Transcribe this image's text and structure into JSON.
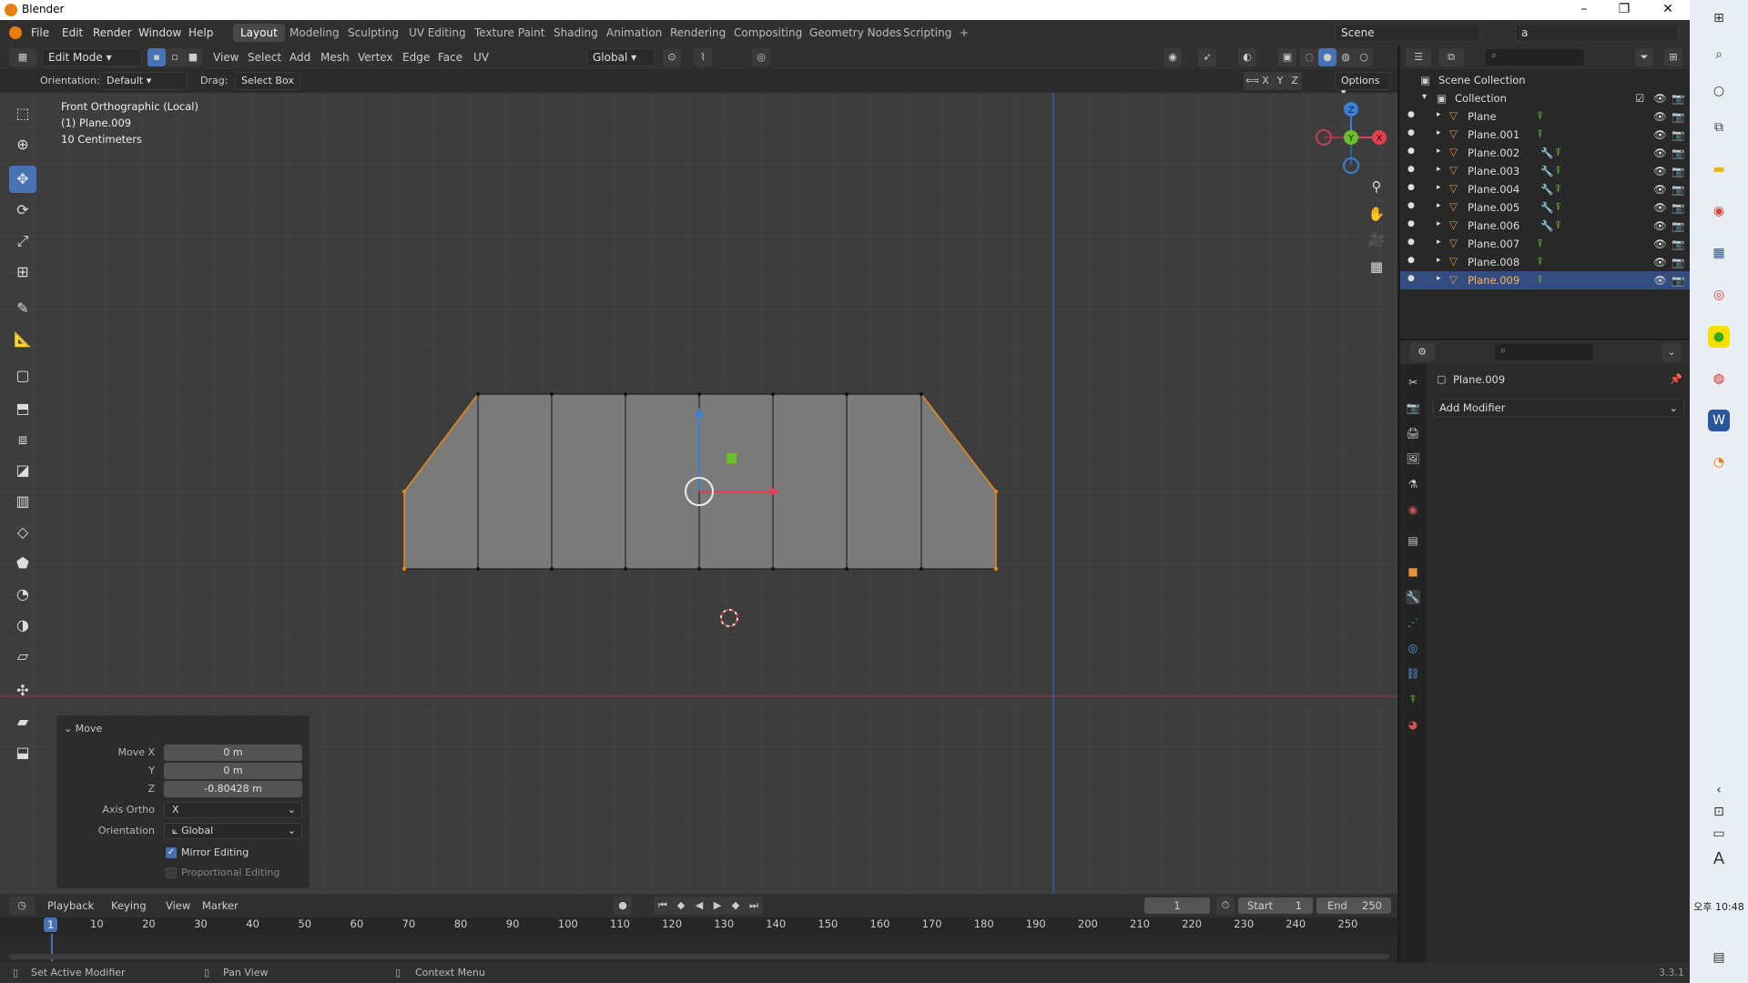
{
  "window": {
    "title": "Blender",
    "minimize": "–",
    "restore": "❐",
    "close": "✕"
  },
  "menus": [
    "File",
    "Edit",
    "Render",
    "Window",
    "Help"
  ],
  "workspaces": [
    "Layout",
    "Modeling",
    "Sculpting",
    "UV Editing",
    "Texture Paint",
    "Shading",
    "Animation",
    "Rendering",
    "Compositing",
    "Geometry Nodes",
    "Scripting",
    "+"
  ],
  "active_workspace": "Layout",
  "scene": {
    "label": "Scene",
    "view_layer": "a"
  },
  "viewport_header": {
    "mode": "Edit Mode",
    "menus": [
      "View",
      "Select",
      "Add",
      "Mesh",
      "Vertex",
      "Edge",
      "Face",
      "UV"
    ],
    "transform_orientation": "Global",
    "orientation_label": "Orientation:",
    "orientation_value": "Default",
    "drag_label": "Drag:",
    "drag_value": "Select Box",
    "axes": [
      "X",
      "Y",
      "Z"
    ],
    "options": "Options"
  },
  "viewport_info": {
    "view": "Front Orthographic (Local)",
    "object": "(1) Plane.009",
    "scale": "10 Centimeters"
  },
  "gizmo": {
    "z": "Z",
    "y": "Y",
    "x": "X"
  },
  "move_panel": {
    "title": "Move",
    "move_x_label": "Move X",
    "move_x": "0 m",
    "y_label": "Y",
    "y": "0 m",
    "z_label": "Z",
    "z": "-0.80428 m",
    "axis_ortho_label": "Axis Ortho",
    "axis_ortho": "X",
    "orientation_label": "Orientation",
    "orientation": "Global",
    "mirror_editing": "Mirror Editing",
    "mirror_checked": true,
    "proportional_editing": "Proportional Editing",
    "proportional_checked": false
  },
  "outliner": {
    "scene_collection": "Scene Collection",
    "collection": "Collection",
    "objects": [
      {
        "name": "Plane",
        "modifier": false
      },
      {
        "name": "Plane.001",
        "modifier": false
      },
      {
        "name": "Plane.002",
        "modifier": true
      },
      {
        "name": "Plane.003",
        "modifier": true
      },
      {
        "name": "Plane.004",
        "modifier": true
      },
      {
        "name": "Plane.005",
        "modifier": true
      },
      {
        "name": "Plane.006",
        "modifier": true
      },
      {
        "name": "Plane.007",
        "modifier": false
      },
      {
        "name": "Plane.008",
        "modifier": false
      },
      {
        "name": "Plane.009",
        "modifier": false,
        "selected": true
      }
    ]
  },
  "properties": {
    "object_name": "Plane.009",
    "add_modifier": "Add Modifier"
  },
  "timeline": {
    "menus": [
      "Playback",
      "Keying",
      "View",
      "Marker"
    ],
    "current_frame": "1",
    "start_label": "Start",
    "start": "1",
    "end_label": "End",
    "end": "250",
    "ticks": [
      "1",
      "10",
      "20",
      "30",
      "40",
      "50",
      "60",
      "70",
      "80",
      "90",
      "100",
      "110",
      "120",
      "130",
      "140",
      "150",
      "160",
      "170",
      "180",
      "190",
      "200",
      "210",
      "220",
      "230",
      "240",
      "250"
    ]
  },
  "statusbar": {
    "left": "Set Active Modifier",
    "middle": "Pan View",
    "right": "Context Menu",
    "version": "3.3.1"
  },
  "taskbar": {
    "time": "오후 10:48",
    "ime": "A"
  },
  "colors": {
    "accent": "#4772b3",
    "selection": "#334d80",
    "mesh_edge_orange": "#e88a14",
    "x_axis": "#e63f4f",
    "y_axis": "#6bbf2e",
    "z_axis": "#3b7fd6"
  }
}
